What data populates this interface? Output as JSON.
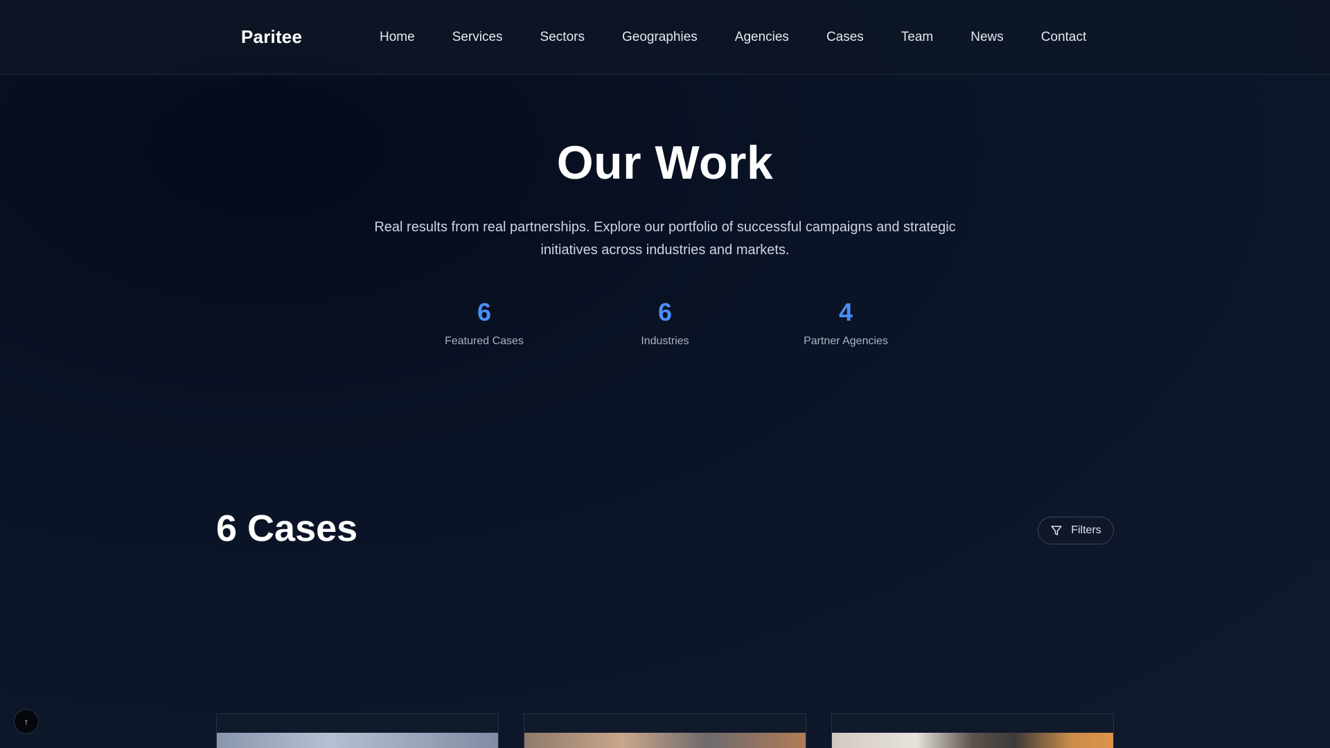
{
  "brand": "Paritee",
  "nav": [
    "Home",
    "Services",
    "Sectors",
    "Geographies",
    "Agencies",
    "Cases",
    "Team",
    "News",
    "Contact"
  ],
  "hero": {
    "title": "Our Work",
    "subtitle": "Real results from real partnerships. Explore our portfolio of successful campaigns and strategic initiatives across industries and markets."
  },
  "stats": [
    {
      "value": "6",
      "label": "Featured Cases"
    },
    {
      "value": "6",
      "label": "Industries"
    },
    {
      "value": "4",
      "label": "Partner Agencies"
    }
  ],
  "cases": {
    "title": "6 Cases",
    "filters_label": "Filters"
  },
  "scroll_top_glyph": "↑",
  "colors": {
    "accent": "#4c8ef7",
    "background": "#0b1426"
  }
}
